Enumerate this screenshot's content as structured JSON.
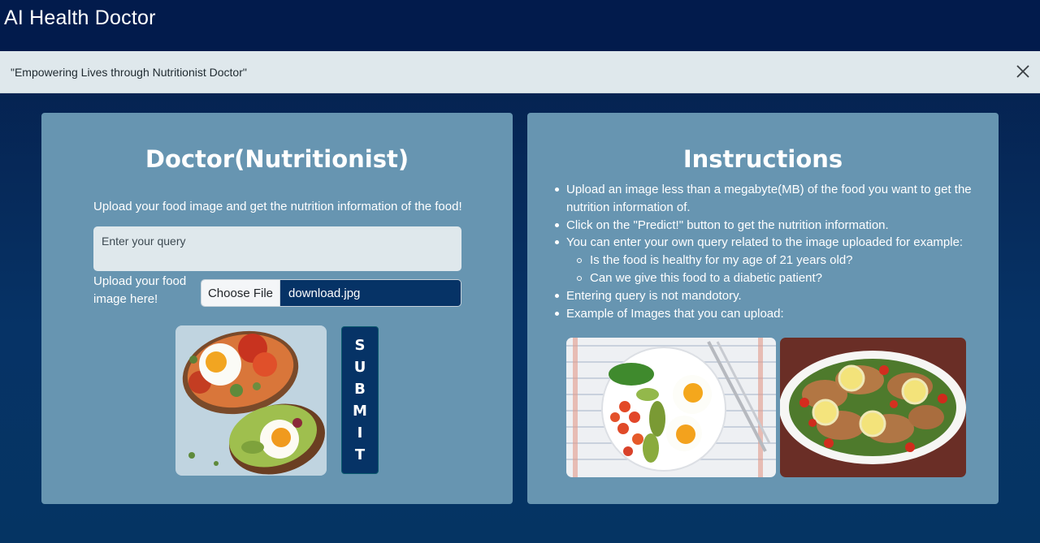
{
  "app": {
    "title": "AI Health Doctor"
  },
  "alert": {
    "text": "\"Empowering Lives through Nutritionist Doctor\"",
    "close_icon": "close-icon"
  },
  "left_panel": {
    "heading": "Doctor(Nutritionist)",
    "subtitle": "Upload your food image and get the nutrition information of the food!",
    "query_placeholder": "Enter your query",
    "upload_label": "Upload your food image here!",
    "choose_file_label": "Choose File",
    "file_name": "download.jpg",
    "submit_letters": [
      "S",
      "U",
      "B",
      "M",
      "I",
      "T"
    ]
  },
  "right_panel": {
    "heading": "Instructions",
    "items": [
      {
        "level": 1,
        "text": "Upload an image less than a megabyte(MB) of the food you want to get the nutrition information of."
      },
      {
        "level": 1,
        "text": "Click on the \"Predict!\" button to get the nutrition information."
      },
      {
        "level": 1,
        "text": "You can enter your own query related to the image uploaded for example:"
      },
      {
        "level": 2,
        "text": "Is the food is healthy for my age of 21 years old?"
      },
      {
        "level": 2,
        "text": "Can we give this food to a diabetic patient?"
      },
      {
        "level": 1,
        "text": "Entering query is not mandotory."
      },
      {
        "level": 1,
        "text": "Example of Images that you can upload:"
      }
    ]
  },
  "colors": {
    "topbar": "#021b4c",
    "background": "#063366",
    "panel": "#6795b1",
    "alert": "#dfe8ec",
    "button": "#063366"
  }
}
